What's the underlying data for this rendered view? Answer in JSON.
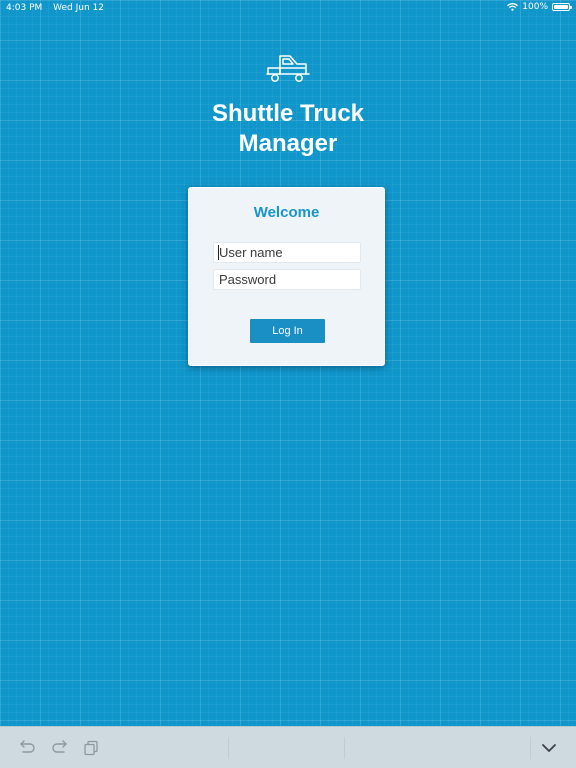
{
  "status_bar": {
    "time": "4:03 PM",
    "date": "Wed Jun 12",
    "battery": "100%",
    "battery_level": 1.0,
    "icons": [
      "wifi-icon",
      "battery-icon"
    ]
  },
  "header": {
    "logo_icon": "shuttle-truck-icon",
    "title_line1": "Shuttle Truck",
    "title_line2": "Manager"
  },
  "login": {
    "heading": "Welcome",
    "username_placeholder": "User name",
    "username_value": "",
    "password_placeholder": "Password",
    "password_value": "",
    "button_label": "Log In"
  },
  "shortcut_bar": {
    "icons": [
      "undo-icon",
      "redo-icon",
      "paste-icon",
      "keyboard-dismiss-icon"
    ]
  },
  "colors": {
    "background": "#1096cb",
    "accent": "#1a8fc4",
    "card": "#eef4f8",
    "shortcut_bar": "#cfd9e0"
  }
}
